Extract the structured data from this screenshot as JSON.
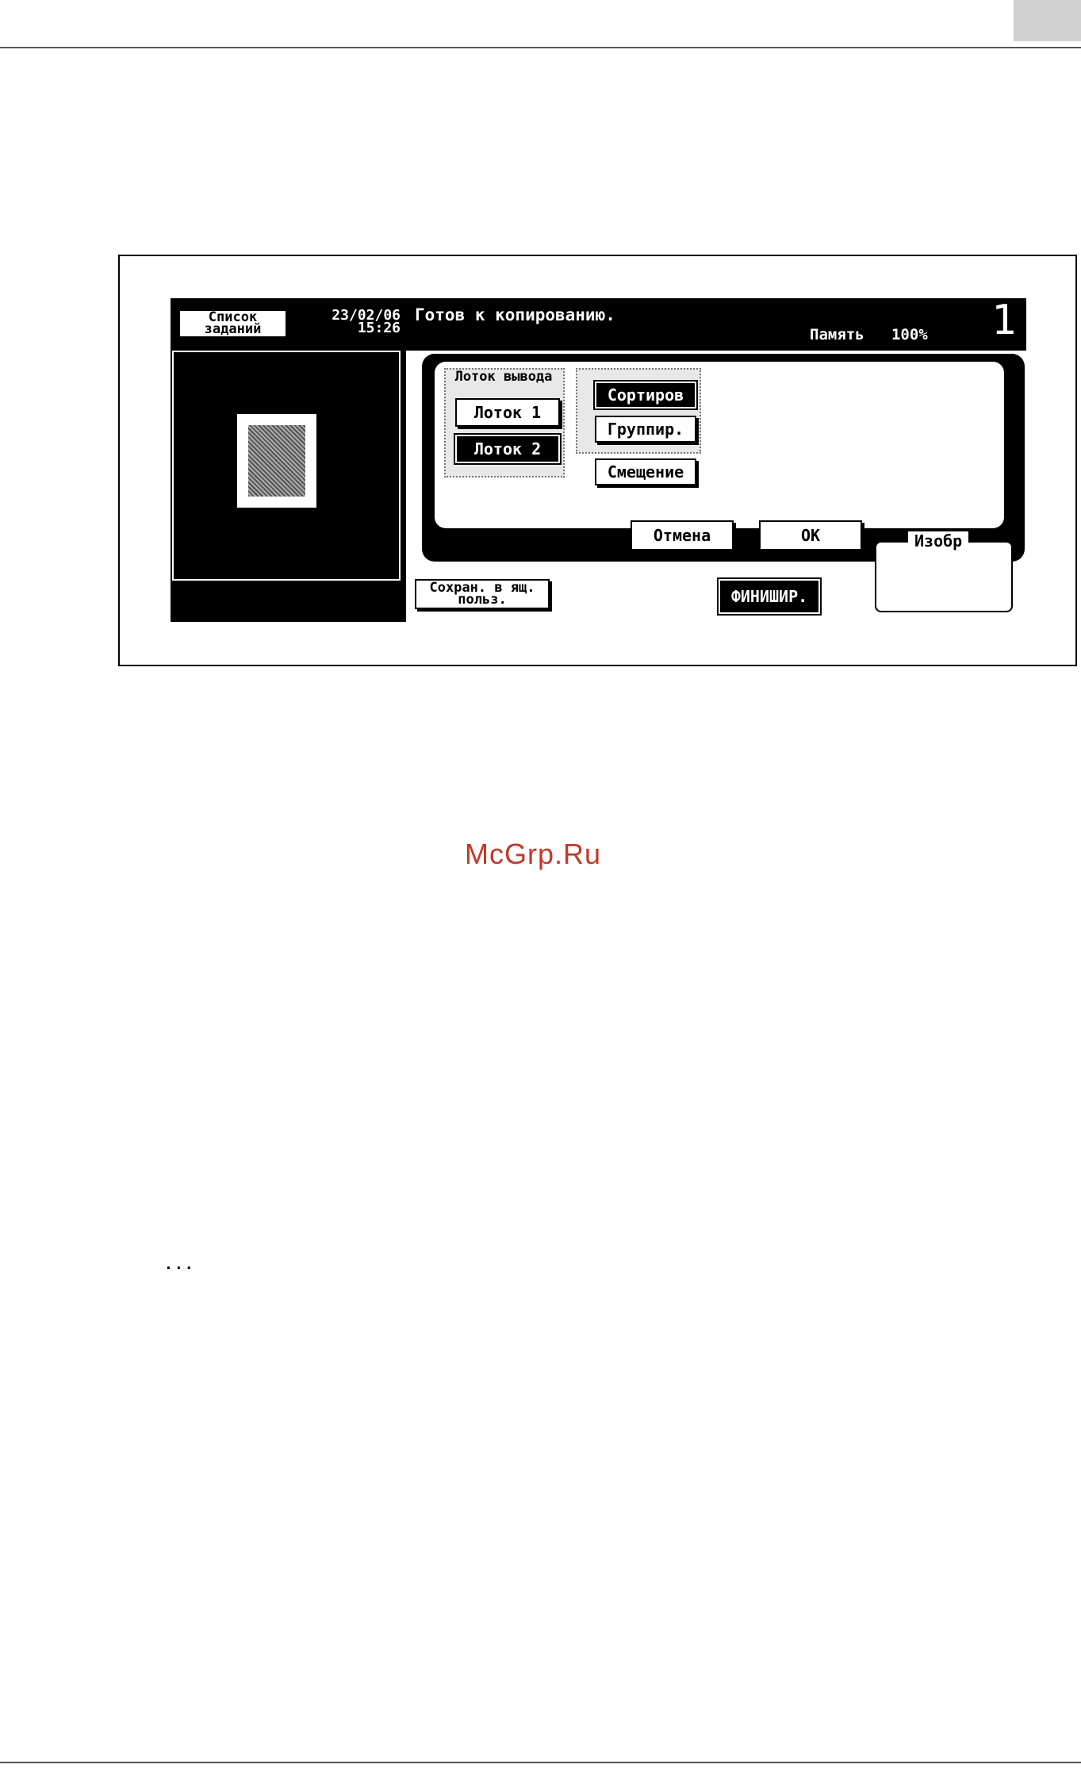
{
  "screen": {
    "job_list_label": "Список заданий",
    "date": "23/02/06",
    "time": "15:26",
    "status": "Готов к копированию.",
    "memory_label": "Память",
    "memory_value": "100%",
    "copy_count": "1",
    "output_tray": {
      "title": "Лоток вывода",
      "tray1": "Лоток 1",
      "tray2": "Лоток 2",
      "selected": "tray2"
    },
    "sorting": {
      "sort": "Сортиров",
      "group": "Группир.",
      "selected": "sort"
    },
    "offset": "Смещение",
    "cancel": "Отмена",
    "ok": "OK",
    "save_to_box": "Сохран. в ящ. польз.",
    "finishing": "ФИНИШИР.",
    "image_panel_title": "Изобр"
  },
  "watermark": "McGrp.Ru",
  "continuation": "..."
}
